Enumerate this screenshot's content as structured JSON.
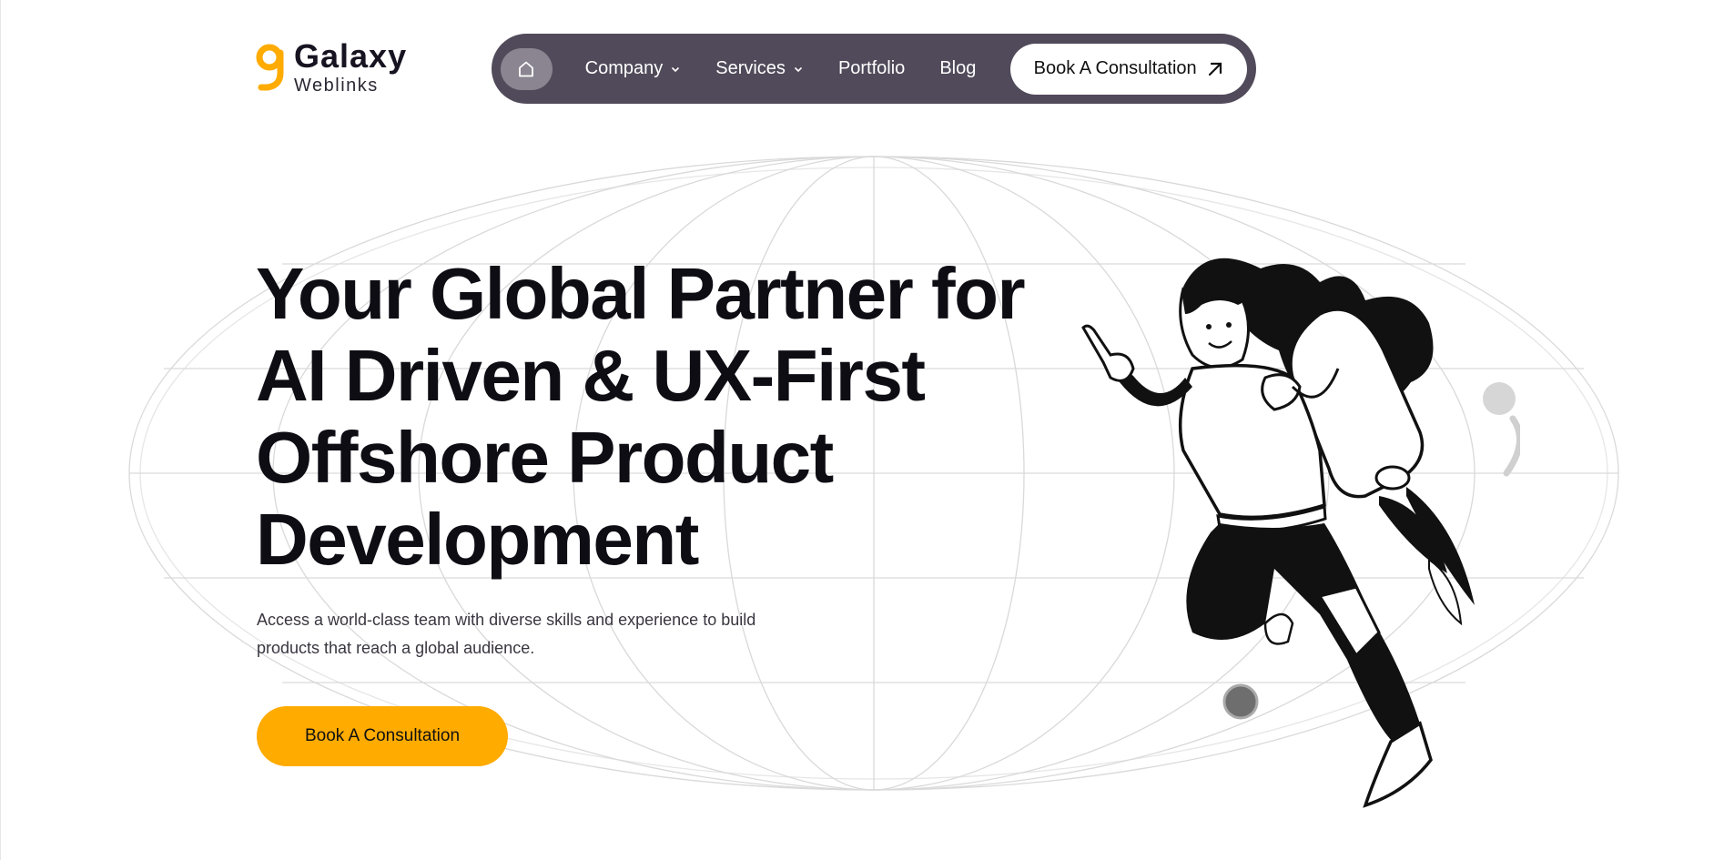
{
  "brand": {
    "name": "Galaxy",
    "tagline": "Weblinks",
    "color": "#ffab00"
  },
  "nav": {
    "home_icon": "home-icon",
    "items": [
      {
        "label": "Company",
        "has_dropdown": true
      },
      {
        "label": "Services",
        "has_dropdown": true
      },
      {
        "label": "Portfolio",
        "has_dropdown": false
      },
      {
        "label": "Blog",
        "has_dropdown": false
      }
    ],
    "cta_label": "Book A Consultation",
    "cta_icon": "arrow-up-right-icon",
    "background": "#514a5a"
  },
  "hero": {
    "title_lines": [
      "Your Global Partner for",
      "AI Driven & UX-First",
      "Offshore Product",
      "Development"
    ],
    "subtitle": "Access a world-class team with diverse skills and experience to build products that reach a global audience.",
    "cta_label": "Book A Consultation",
    "cta_color": "#ffab00",
    "illustration": "woman-with-jetpack-illustration",
    "background_graphic": "globe-wireframe"
  }
}
